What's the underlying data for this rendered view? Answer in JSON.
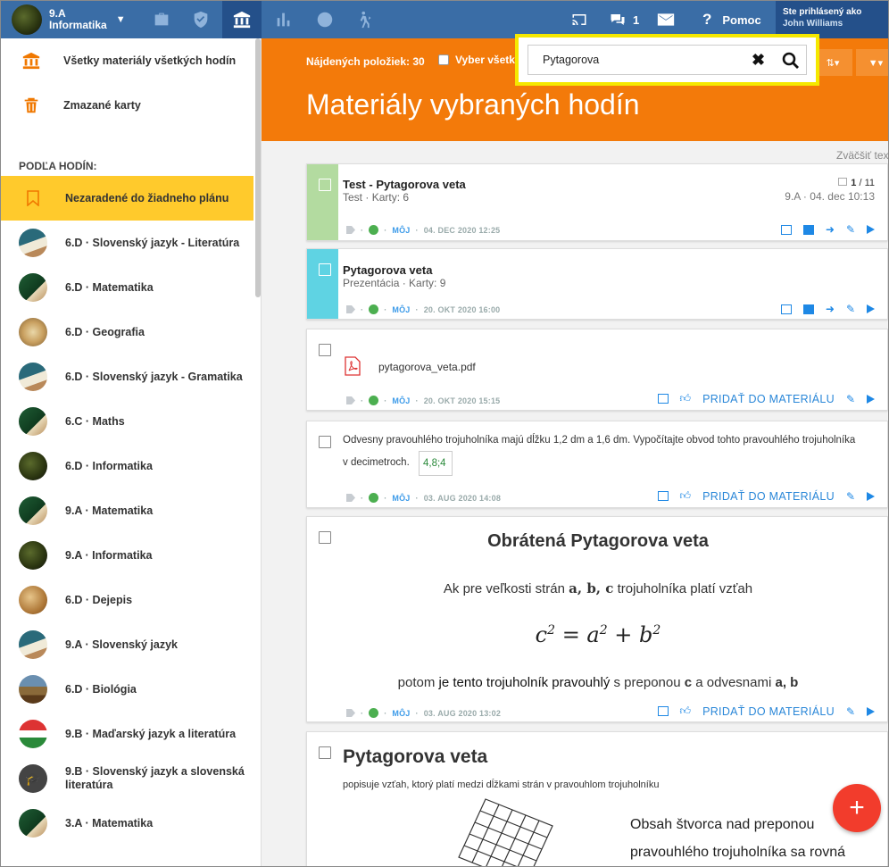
{
  "topbar": {
    "class_line1": "9.A",
    "class_line2": "Informatika",
    "messages_count": "1",
    "help_label": "Pomoc",
    "login_label": "Ste prihlásený ako",
    "user_name": "John Williams"
  },
  "sidebar": {
    "all_materials": "Všetky materiály všetkých hodín",
    "deleted_cards": "Zmazané karty",
    "section_heading": "PODĽA HODÍN:",
    "unassigned": "Nezaradené do žiadneho plánu",
    "items": [
      {
        "label": "6.D · Slovenský jazyk - Literatúra"
      },
      {
        "label": "6.D · Matematika"
      },
      {
        "label": "6.D · Geografia"
      },
      {
        "label": "6.D · Slovenský jazyk - Gramatika"
      },
      {
        "label": "6.C · Maths"
      },
      {
        "label": "6.D · Informatika"
      },
      {
        "label": "9.A · Matematika"
      },
      {
        "label": "9.A · Informatika"
      },
      {
        "label": "6.D · Dejepis"
      },
      {
        "label": "9.A · Slovenský jazyk"
      },
      {
        "label": "6.D · Biológia"
      },
      {
        "label": "9.B · Maďarský jazyk a literatúra"
      },
      {
        "label": "9.B · Slovenský jazyk a slovenská literatúra"
      },
      {
        "label": "3.A · Matematika"
      }
    ]
  },
  "main": {
    "found_label": "Nájdených položiek: 30",
    "select_all": "Vyber všetko",
    "page_title": "Materiály vybraných hodín",
    "search_value": "Pytagorova",
    "zoom_label": "Zväčšiť tex",
    "own_label": "MÔJ",
    "add_label": "PRIDAŤ DO MATERIÁLU",
    "cards": [
      {
        "title": "Test - Pytagorova veta",
        "type": "Test",
        "cards": "Karty: 6",
        "count_bold": "1",
        "count_total": "/ 11",
        "cls_date": "9.A · 04. dec 10:13",
        "date": "04. DEC 2020 12:25",
        "color": "#b3dba0"
      },
      {
        "title": "Pytagorova veta",
        "type": "Prezentácia",
        "cards": "Karty: 9",
        "date": "20. OKT 2020 16:00",
        "color": "#5fd3e3"
      },
      {
        "file": "pytagorova_veta.pdf",
        "date": "20. OKT 2020 15:15"
      },
      {
        "text_line1": "Odvesny pravouhlého trojuholníka majú dĺžku 1,2 dm a 1,6 dm. Vypočítajte obvod tohto pravouhlého trojuholníka",
        "text_line2": "v decimetroch.",
        "answer": "4,8;4",
        "date": "03. AUG 2020 14:08"
      },
      {
        "heading": "Obrátená Pytagorova veta",
        "line1_pre": "Ak pre veľkosti strán",
        "line1_vars": "a, b, c",
        "line1_post": "trojuholníka platí vzťah",
        "formula_c": "c",
        "formula_rest": "= a",
        "formula_b": "+ b",
        "exp": "2",
        "line2_pre": "potom",
        "line2_mid": "je tento trojuholník pravouhlý",
        "line2_post": "s preponou",
        "line2_c": "c",
        "line2_post2": "a odvesnami",
        "line2_ab": "a, b",
        "date": "03. AUG 2020 13:02"
      },
      {
        "heading": "Pytagorova veta",
        "subtitle": "popisuje vzťah, ktorý platí medzi dĺžkami strán v pravouhlom trojuholníku",
        "right_line1": "Obsah štvorca nad preponou",
        "right_line2": "pravouhlého trojuholníka sa rovná"
      }
    ]
  },
  "fab_label": "+"
}
